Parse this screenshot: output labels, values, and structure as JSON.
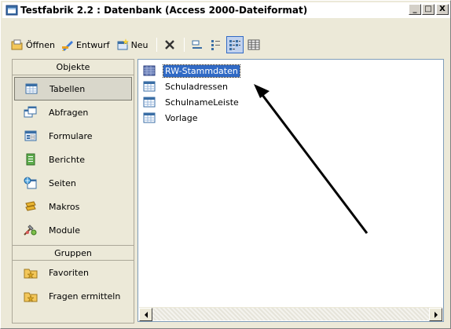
{
  "window": {
    "title": "Testfabrik 2.2 : Datenbank (Access 2000-Dateiformat)",
    "controls": {
      "minimize": "_",
      "maximize": "□",
      "close": "X"
    }
  },
  "toolbar": {
    "open_label": "Öffnen",
    "design_label": "Entwurf",
    "new_label": "Neu",
    "delete_icon": "delete-icon",
    "view_icons": [
      "large-icons-icon",
      "small-icons-icon",
      "list-view-icon",
      "details-view-icon"
    ]
  },
  "objects": {
    "header": "Objekte",
    "items": [
      {
        "label": "Tabellen",
        "icon": "table-icon",
        "selected": true
      },
      {
        "label": "Abfragen",
        "icon": "query-icon",
        "selected": false
      },
      {
        "label": "Formulare",
        "icon": "form-icon",
        "selected": false
      },
      {
        "label": "Berichte",
        "icon": "report-icon",
        "selected": false
      },
      {
        "label": "Seiten",
        "icon": "page-icon",
        "selected": false
      },
      {
        "label": "Makros",
        "icon": "macro-icon",
        "selected": false
      },
      {
        "label": "Module",
        "icon": "module-icon",
        "selected": false
      }
    ]
  },
  "groups": {
    "header": "Gruppen",
    "items": [
      {
        "label": "Favoriten",
        "icon": "folder-star-icon"
      },
      {
        "label": "Fragen ermitteln",
        "icon": "folder-star-icon"
      }
    ]
  },
  "tables": {
    "items": [
      {
        "label": "RW-Stammdaten",
        "selected": true
      },
      {
        "label": "Schuladressen",
        "selected": false
      },
      {
        "label": "SchulnameLeiste",
        "selected": false
      },
      {
        "label": "Vorlage",
        "selected": false
      }
    ]
  },
  "colors": {
    "selection": "#316ac5",
    "window_bg": "#ece9d8",
    "pane_border": "#7f9db9"
  }
}
